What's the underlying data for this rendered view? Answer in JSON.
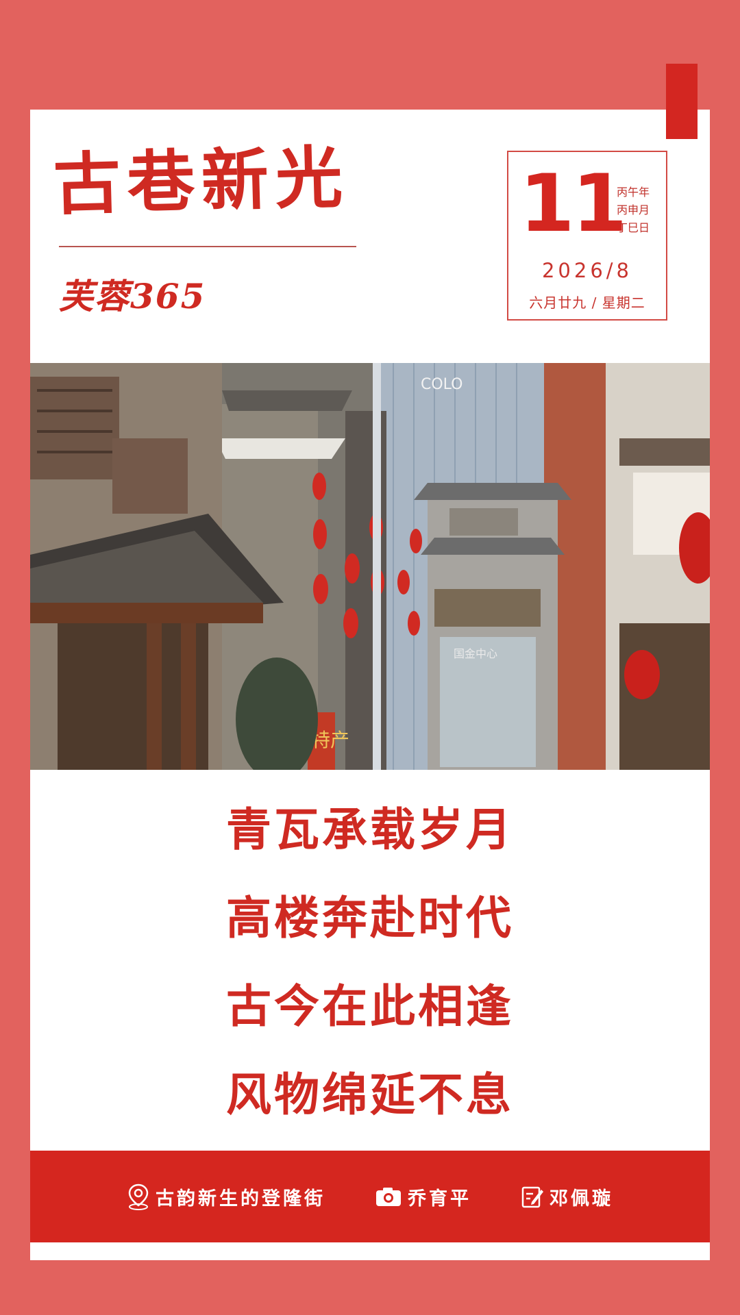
{
  "header": {
    "title": "古巷新光",
    "subtitle": "芙蓉365"
  },
  "date": {
    "day": "11",
    "ganzhi": [
      "丙午年",
      "丙申月",
      "丁巳日"
    ],
    "year_month": "2026/8",
    "lunar": "六月廿九 / 星期二"
  },
  "photo": {
    "signs": [
      "COLO",
      "国金中心",
      "特产"
    ]
  },
  "poem": [
    "青瓦承载岁月",
    "高楼奔赴时代",
    "古今在此相逢",
    "风物绵延不息"
  ],
  "footer": {
    "location": "古韵新生的登隆街",
    "photographer": "乔育平",
    "writer": "邓佩璇"
  },
  "colors": {
    "accent_red": "#d5261f",
    "frame": "#e2625e"
  },
  "icons": [
    "location-pin-icon",
    "camera-icon",
    "edit-icon"
  ]
}
